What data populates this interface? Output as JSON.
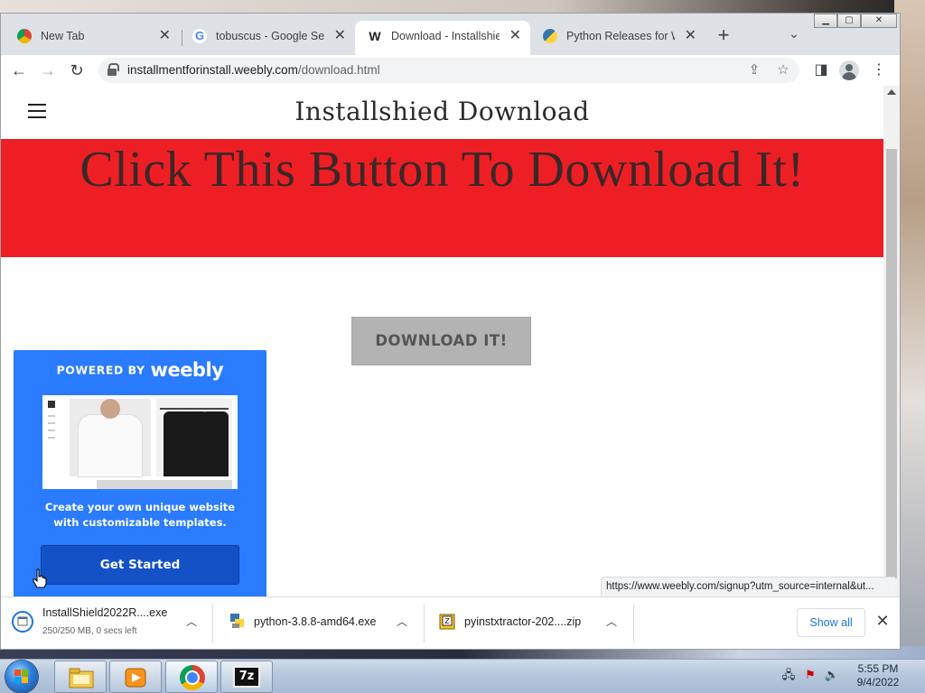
{
  "browser": {
    "tabs": [
      {
        "label": "New Tab",
        "icon": "chrome-icon",
        "active": false
      },
      {
        "label": "tobuscus - Google Search",
        "icon": "google-icon",
        "active": false
      },
      {
        "label": "Download - Installshield",
        "icon": "weebly-icon",
        "active": true
      },
      {
        "label": "Python Releases for Windows",
        "icon": "python-icon",
        "active": false
      }
    ],
    "url_host": "installmentforinstall.weebly.com",
    "url_path": "/download.html",
    "status_url": "https://www.weebly.com/signup?utm_source=internal&ut..."
  },
  "site": {
    "title": "Installshied Download",
    "banner": "Click This Button To Download It!",
    "download_button": "DOWNLOAD IT!",
    "banner_color": "#ee1f24"
  },
  "promo": {
    "powered_by": "POWERED BY",
    "brand": "weebly",
    "text_line1": "Create your own unique website",
    "text_line2": "with customizable templates.",
    "cta": "Get Started",
    "accent": "#2a7bff"
  },
  "downloads": {
    "items": [
      {
        "name": "InstallShield2022R....exe",
        "sub": "250/250 MB, 0 secs left"
      },
      {
        "name": "python-3.8.8-amd64.exe",
        "sub": ""
      },
      {
        "name": "pyinstxtractor-202....zip",
        "sub": ""
      }
    ],
    "show_all": "Show all"
  },
  "taskbar": {
    "time": "5:55 PM",
    "date": "9/4/2022"
  }
}
